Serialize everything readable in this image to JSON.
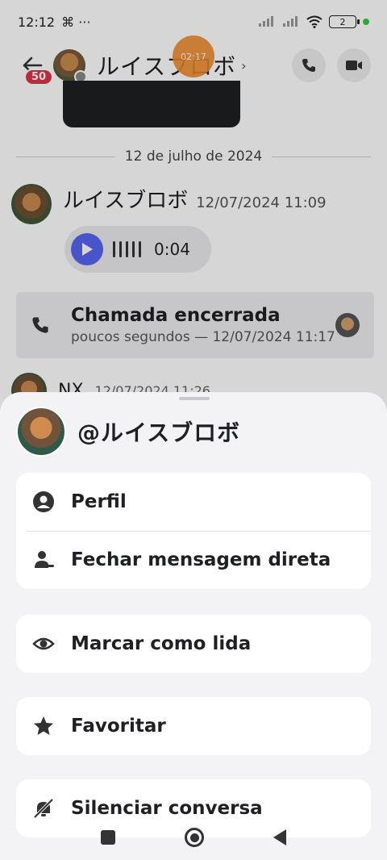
{
  "status_bar": {
    "time": "12:12",
    "extra": "⌘ ···",
    "battery": "2"
  },
  "chat": {
    "back_badge": "50",
    "title": "ルイスブロボ",
    "call_timer": "02:17",
    "date_divider": "12 de julho de 2024",
    "message": {
      "author": "ルイスブロボ",
      "timestamp": "12/07/2024 11:09",
      "voice_duration": "0:04"
    },
    "call_ended": {
      "title": "Chamada encerrada",
      "subtitle": "poucos segundos — 12/07/2024 11:17"
    },
    "next_message": {
      "author": "NX",
      "timestamp": "12/07/2024 11:26"
    }
  },
  "sheet": {
    "handle": "@ルイスブロボ",
    "groups": [
      [
        {
          "label": "Perfil",
          "icon": "profile-icon"
        },
        {
          "label": "Fechar mensagem direta",
          "icon": "close-dm-icon"
        }
      ],
      [
        {
          "label": "Marcar como lida",
          "icon": "eye-icon"
        }
      ],
      [
        {
          "label": "Favoritar",
          "icon": "star-icon"
        }
      ],
      [
        {
          "label": "Silenciar conversa",
          "icon": "mute-icon"
        }
      ]
    ]
  },
  "colors": {
    "accent": "#5865f2",
    "badge": "#e0334a",
    "call_indicator": "#f08b2c"
  }
}
